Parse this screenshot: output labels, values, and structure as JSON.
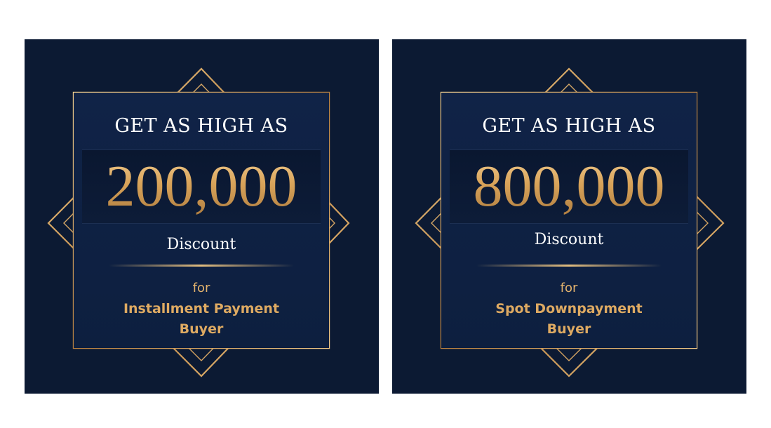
{
  "colors": {
    "card_background": "#0c1a33",
    "panel_background": "#102347",
    "gold": "#d9a45a",
    "text_white": "#ffffff"
  },
  "cards": [
    {
      "headline": "GET AS HIGH AS",
      "amount": "200,000",
      "discount_label": "Discount",
      "for_label": "for",
      "buyer_line1": "Installment Payment",
      "buyer_line2": "Buyer"
    },
    {
      "headline": "GET AS HIGH AS",
      "amount": "800,000",
      "discount_label": "Discount",
      "for_label": "for",
      "buyer_line1": "Spot Downpayment",
      "buyer_line2": "Buyer"
    }
  ]
}
